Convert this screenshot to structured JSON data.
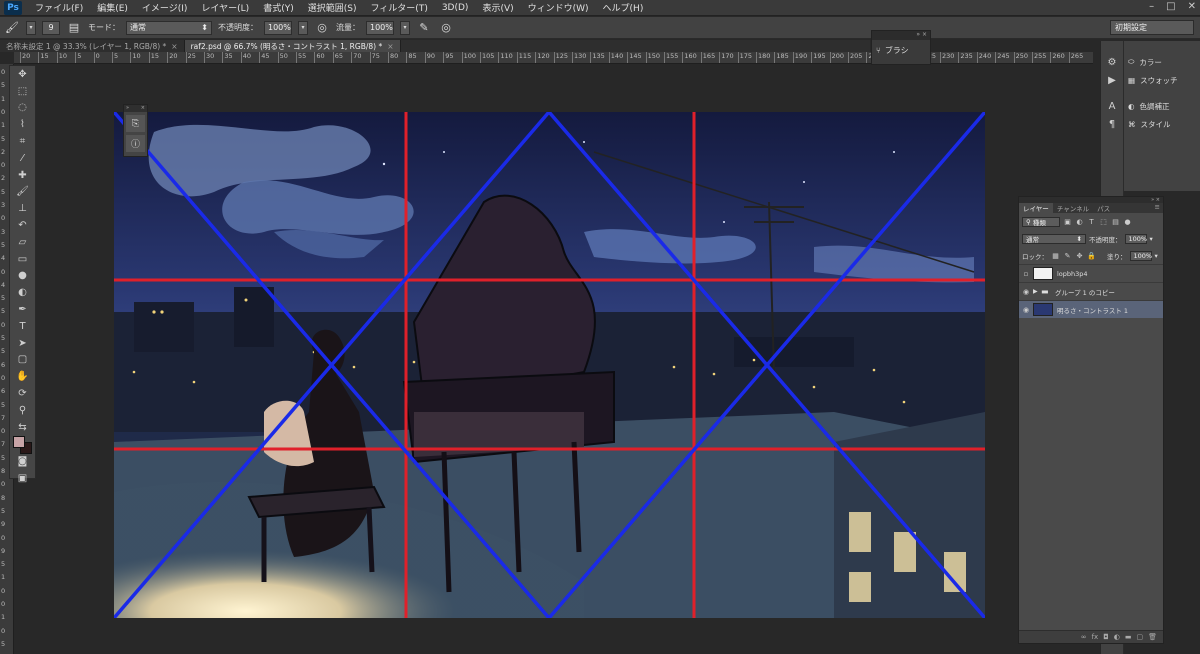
{
  "app": {
    "logo": "Ps",
    "window_controls": [
      "–",
      "□",
      "✕"
    ]
  },
  "menu": [
    "ファイル(F)",
    "編集(E)",
    "イメージ(I)",
    "レイヤー(L)",
    "書式(Y)",
    "選択範囲(S)",
    "フィルター(T)",
    "3D(D)",
    "表示(V)",
    "ウィンドウ(W)",
    "ヘルプ(H)"
  ],
  "options": {
    "brush_size": "9",
    "mode_label": "モード：",
    "mode_value": "通常",
    "opacity_label": "不透明度：",
    "opacity_value": "100%",
    "flow_label": "流量：",
    "flow_value": "100%",
    "workspace": "初期設定"
  },
  "tabs": [
    {
      "label": "名称未設定 1 @ 33.3% (レイヤー 1, RGB/8) *",
      "active": false
    },
    {
      "label": "raf2.psd @ 66.7% (明るさ・コントラスト 1, RGB/8) *",
      "active": true
    }
  ],
  "ruler_top": [
    "20",
    "15",
    "10",
    "5",
    "0",
    "5",
    "10",
    "15",
    "20",
    "25",
    "30",
    "35",
    "40",
    "45",
    "50",
    "55",
    "60",
    "65",
    "70",
    "75",
    "80",
    "85",
    "90",
    "95",
    "100",
    "105",
    "110",
    "115",
    "120",
    "125",
    "130",
    "135",
    "140",
    "145",
    "150",
    "155",
    "160",
    "165",
    "170",
    "175",
    "180",
    "185",
    "190",
    "195",
    "200",
    "205",
    "210",
    "215",
    "220",
    "225",
    "230",
    "235",
    "240",
    "245",
    "250",
    "255",
    "260",
    "265"
  ],
  "ruler_left": [
    "0",
    "5",
    "1",
    "0",
    "1",
    "5",
    "2",
    "0",
    "2",
    "5",
    "3",
    "0",
    "3",
    "5",
    "4",
    "0",
    "4",
    "5",
    "5",
    "0",
    "5",
    "5",
    "6",
    "0",
    "6",
    "5",
    "7",
    "0",
    "7",
    "5",
    "8",
    "0",
    "8",
    "5",
    "9",
    "0",
    "9",
    "5",
    "1",
    "0",
    "0",
    "1",
    "0",
    "5"
  ],
  "tools": [
    "move-icon",
    "marquee-icon",
    "lasso-icon",
    "quick-select-icon",
    "crop-icon",
    "eyedropper-icon",
    "healing-icon",
    "brush-icon",
    "stamp-icon",
    "history-brush-icon",
    "eraser-icon",
    "gradient-icon",
    "blur-icon",
    "dodge-icon",
    "pen-icon",
    "type-icon",
    "path-select-icon",
    "shape-icon",
    "hand-icon",
    "rotate-view-icon",
    "zoom-icon",
    "swap-colors-icon",
    "foreground-color",
    "quick-mask-icon",
    "screen-mode-icon"
  ],
  "brush_panel": {
    "title": "ブラシ"
  },
  "dock": {
    "items": [
      {
        "icon": "color-icon",
        "label": "カラー"
      },
      {
        "icon": "swatches-icon",
        "label": "スウォッチ"
      },
      {
        "icon": "adjustments-icon",
        "label": "色調補正"
      },
      {
        "icon": "styles-icon",
        "label": "スタイル"
      }
    ]
  },
  "layers": {
    "tabs": [
      "レイヤー",
      "チャンネル",
      "パス"
    ],
    "filter_label": "種類",
    "blend_mode": "通常",
    "opacity_label": "不透明度：",
    "opacity_value": "100%",
    "lock_label": "ロック：",
    "fill_label": "塗り：",
    "fill_value": "100%",
    "items": [
      {
        "name": "lopbh3p4",
        "visible": false,
        "selected": false
      },
      {
        "name": "グループ 1 のコピー",
        "visible": true,
        "selected": false
      },
      {
        "name": "明るさ・コントラスト 1",
        "visible": true,
        "selected": true
      }
    ]
  },
  "colors": {
    "foreground": "#c7a3a6",
    "background": "#2a1818",
    "grid_red": "#e0202a",
    "grid_blue": "#1a2ae8"
  }
}
